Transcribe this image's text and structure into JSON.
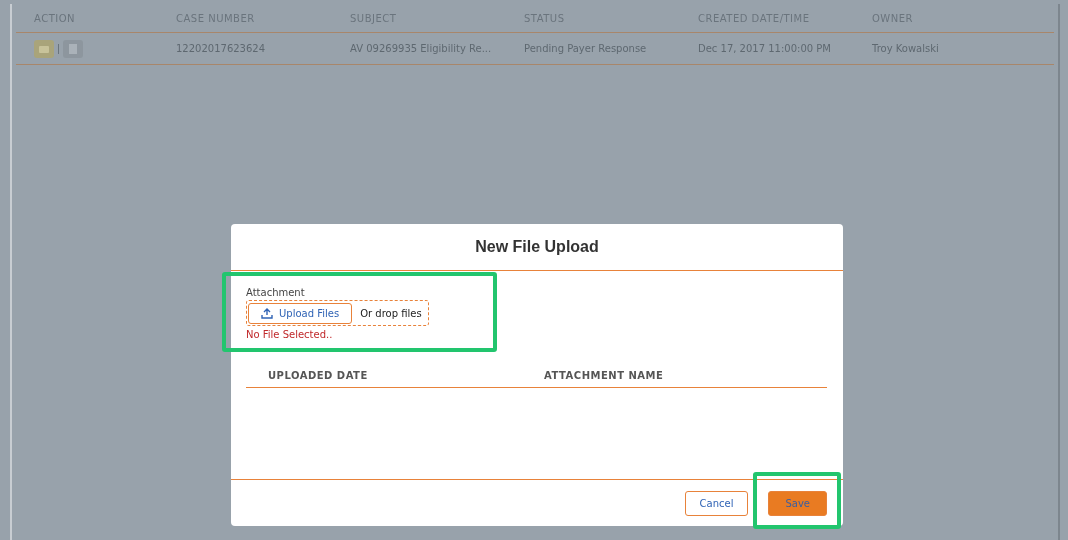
{
  "table": {
    "columns": [
      "ACTION",
      "CASE NUMBER",
      "SUBJECT",
      "STATUS",
      "CREATED DATE/TIME",
      "OWNER"
    ],
    "rows": [
      {
        "case_number": "12202017623624",
        "subject": "AV 09269935 Eligibility Re...",
        "status": "Pending Payer Response",
        "created": "Dec 17, 2017 11:00:00 PM",
        "owner": "Troy Kowalski"
      }
    ]
  },
  "dialog": {
    "title": "New File Upload",
    "attachment_label": "Attachment",
    "upload_button": "Upload Files",
    "drop_hint": "Or drop files",
    "error": "No File Selected..",
    "columns": [
      "UPLOADED DATE",
      "ATTACHMENT NAME"
    ],
    "buttons": [
      {
        "label": "Cancel",
        "kind": "secondary"
      },
      {
        "label": "Save",
        "kind": "primary"
      }
    ]
  }
}
